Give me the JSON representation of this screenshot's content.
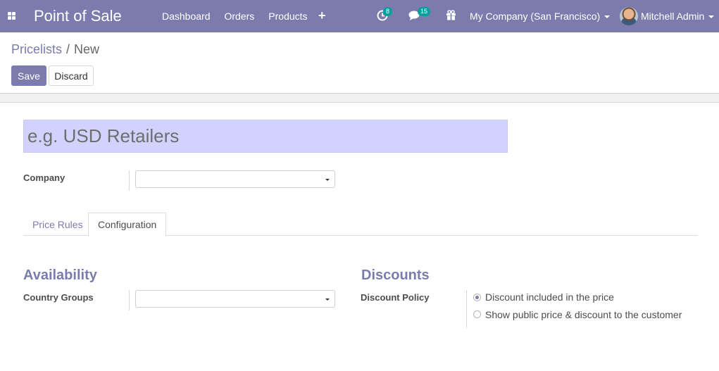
{
  "navbar": {
    "app_title": "Point of Sale",
    "menu": [
      "Dashboard",
      "Orders",
      "Products"
    ],
    "plus_label": "+",
    "activity_count": "8",
    "message_count": "15",
    "company": "My Company (San Francisco)",
    "user": "Mitchell Admin",
    "bg_color": "#7c7bad",
    "badge_color": "#00a09d"
  },
  "breadcrumb": {
    "parent": "Pricelists",
    "separator": "/",
    "current": "New"
  },
  "buttons": {
    "save": "Save",
    "discard": "Discard"
  },
  "form": {
    "name_placeholder": "e.g. USD Retailers",
    "company_label": "Company",
    "company_value": ""
  },
  "tabs": {
    "price_rules": "Price Rules",
    "configuration": "Configuration",
    "active": "Configuration"
  },
  "configuration": {
    "availability_title": "Availability",
    "country_groups_label": "Country Groups",
    "country_groups_value": "",
    "discounts_title": "Discounts",
    "discount_policy_label": "Discount Policy",
    "discount_options": [
      {
        "label": "Discount included in the price",
        "checked": true
      },
      {
        "label": "Show public price & discount to the customer",
        "checked": false
      }
    ]
  }
}
